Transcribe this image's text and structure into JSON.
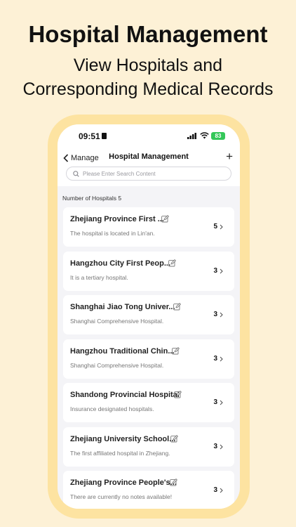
{
  "promo": {
    "title": "Hospital Management",
    "subtitle_line1": "View Hospitals and",
    "subtitle_line2": "Corresponding Medical Records"
  },
  "status_bar": {
    "time": "09:51",
    "battery": "83"
  },
  "nav": {
    "back_label": "Manage",
    "title": "Hospital Management",
    "add_label": "+"
  },
  "search": {
    "placeholder": "Please Enter Search Content"
  },
  "count_label": "Number of Hospitals 5",
  "hospitals": [
    {
      "name": "Zhejiang Province First ...",
      "note": "The hospital is located in Lin'an.",
      "count": "5"
    },
    {
      "name": "Hangzhou City First Peop...",
      "note": "It is a tertiary hospital.",
      "count": "3"
    },
    {
      "name": "Shanghai Jiao Tong Univer...",
      "note": "Shanghai Comprehensive Hospital.",
      "count": "3"
    },
    {
      "name": "Hangzhou Traditional Chin...",
      "note": "Shanghai Comprehensive Hospital.",
      "count": "3"
    },
    {
      "name": "Shandong Provincial Hospital",
      "note": "Insurance designated hospitals.",
      "count": "3"
    },
    {
      "name": "Zhejiang University School...",
      "note": "The first affiliated hospital in Zhejiang.",
      "count": "3"
    },
    {
      "name": "Zhejiang Province People's...",
      "note": "There are currently no notes available!",
      "count": "3"
    }
  ],
  "icons": {
    "back": "chevron-left-icon",
    "search": "search-icon",
    "edit": "edit-icon",
    "row_arrow": "chevron-right-icon"
  },
  "colors": {
    "background": "#fdf1d6",
    "phone_frame": "#fde3a1",
    "battery": "#34c759"
  }
}
